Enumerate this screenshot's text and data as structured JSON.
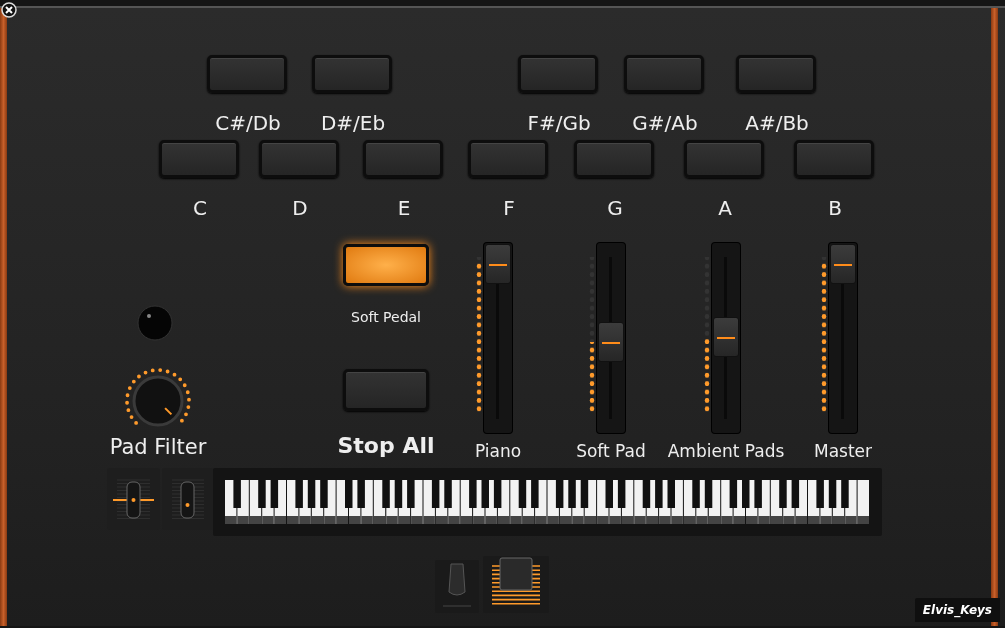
{
  "sharp_keys": [
    {
      "label": "C#/Db",
      "on": false
    },
    {
      "label": "D#/Eb",
      "on": false
    },
    {
      "label": "F#/Gb",
      "on": false
    },
    {
      "label": "G#/Ab",
      "on": false
    },
    {
      "label": "A#/Bb",
      "on": false
    }
  ],
  "natural_keys": [
    {
      "label": "C",
      "on": false
    },
    {
      "label": "D",
      "on": false
    },
    {
      "label": "E",
      "on": false
    },
    {
      "label": "F",
      "on": false
    },
    {
      "label": "G",
      "on": false
    },
    {
      "label": "A",
      "on": false
    },
    {
      "label": "B",
      "on": false
    }
  ],
  "pad_filter": {
    "label": "Pad Filter",
    "level": 1
  },
  "buttons": [
    {
      "label": "Soft Pedal",
      "kind": "small",
      "on": true
    },
    {
      "label": "Stop All",
      "kind": "large",
      "on": false
    }
  ],
  "faders": [
    {
      "label": "Piano",
      "level": 1
    },
    {
      "label": "Soft Pad",
      "level": 0.47
    },
    {
      "label": "Ambient Pads",
      "level": 0.51
    },
    {
      "label": "Master",
      "level": 1
    }
  ],
  "instrument_name": "Elvis_Keys"
}
